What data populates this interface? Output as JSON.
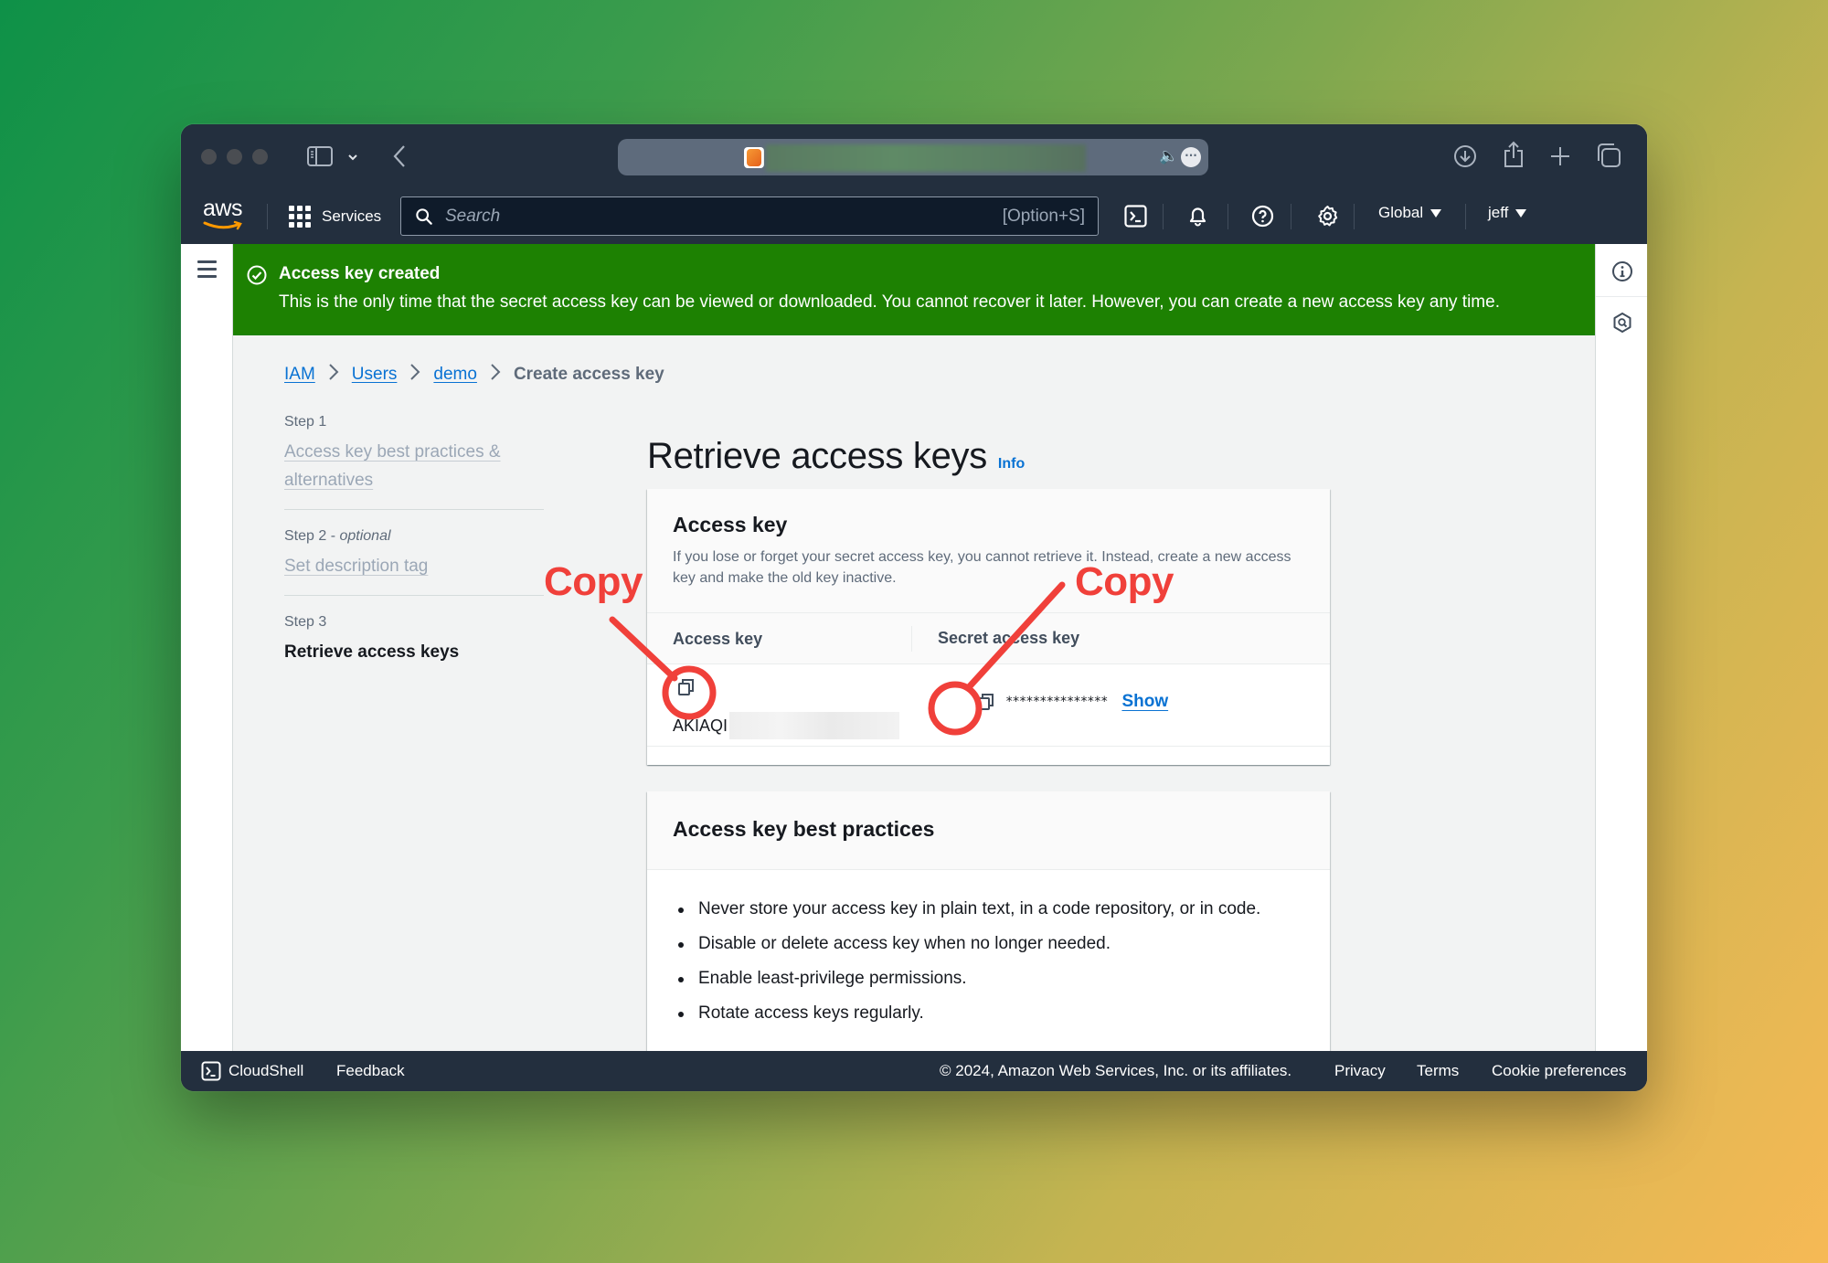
{
  "browser": {
    "url_blurred": true,
    "favicon": "aws-orange-cube-icon"
  },
  "nav": {
    "logo": "aws",
    "services_label": "Services",
    "search_placeholder": "Search",
    "search_shortcut": "[Option+S]",
    "icons": [
      "cloudshell-icon",
      "bell-icon",
      "help-icon",
      "gear-icon"
    ],
    "region_label": "Global",
    "user_label": "jeff"
  },
  "banner": {
    "status": "success",
    "title": "Access key created",
    "message": "This is the only time that the secret access key can be viewed or downloaded. You cannot recover it later. However, you can create a new access key any time.",
    "color": "#1d8102"
  },
  "breadcrumb": {
    "items": [
      "IAM",
      "Users",
      "demo"
    ],
    "current": "Create access key"
  },
  "steps": [
    {
      "number": "Step 1",
      "optional": "",
      "label": "Access key best practices & alternatives",
      "active": false
    },
    {
      "number": "Step 2 - ",
      "optional": "optional",
      "label": "Set description tag",
      "active": false
    },
    {
      "number": "Step 3",
      "optional": "",
      "label": "Retrieve access keys",
      "active": true
    }
  ],
  "page": {
    "title": "Retrieve access keys",
    "info_link": "Info"
  },
  "access_key_card": {
    "title": "Access key",
    "description": "If you lose or forget your secret access key, you cannot retrieve it. Instead, create a new access key and make the old key inactive.",
    "col_access_key": "Access key",
    "col_secret_key": "Secret access key",
    "access_key_value": "AKIAQI",
    "secret_key_masked": "***************",
    "show_label": "Show"
  },
  "best_practices_card": {
    "title": "Access key best practices",
    "items": [
      "Never store your access key in plain text, in a code repository, or in code.",
      "Disable or delete access key when no longer needed.",
      "Enable least-privilege permissions.",
      "Rotate access keys regularly."
    ]
  },
  "footer": {
    "cloudshell": "CloudShell",
    "feedback": "Feedback",
    "copyright": "© 2024, Amazon Web Services, Inc. or its affiliates.",
    "privacy": "Privacy",
    "terms": "Terms",
    "cookies": "Cookie preferences"
  },
  "annotations": {
    "label_left": "Copy",
    "label_right": "Copy",
    "color": "#f0403a"
  }
}
